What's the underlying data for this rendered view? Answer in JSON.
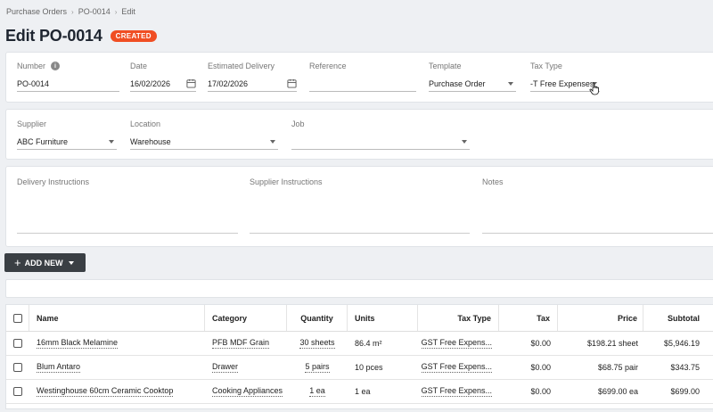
{
  "breadcrumb": {
    "items": [
      "Purchase Orders",
      "PO-0014",
      "Edit"
    ]
  },
  "header": {
    "title": "Edit PO-0014",
    "status": "CREATED"
  },
  "form": {
    "number": {
      "label": "Number",
      "value": "PO-0014"
    },
    "date": {
      "label": "Date",
      "value": "16/02/2026"
    },
    "estimated_delivery": {
      "label": "Estimated Delivery",
      "value": "17/02/2026"
    },
    "reference": {
      "label": "Reference",
      "value": ""
    },
    "template": {
      "label": "Template",
      "value": "Purchase Order"
    },
    "tax_type": {
      "label": "Tax Type",
      "value": "-T Free Expenses"
    },
    "supplier": {
      "label": "Supplier",
      "value": "ABC Furniture"
    },
    "location": {
      "label": "Location",
      "value": "Warehouse"
    },
    "job": {
      "label": "Job",
      "value": ""
    },
    "delivery_instructions": {
      "label": "Delivery Instructions"
    },
    "supplier_instructions": {
      "label": "Supplier Instructions"
    },
    "notes": {
      "label": "Notes"
    }
  },
  "actions": {
    "add_new": "ADD NEW"
  },
  "table": {
    "columns": [
      "Name",
      "Category",
      "Quantity",
      "Units",
      "Tax Type",
      "Tax",
      "Price",
      "Subtotal"
    ],
    "rows": [
      {
        "name": "16mm Black Melamine",
        "category": "PFB MDF Grain",
        "quantity": "30 sheets",
        "units": "86.4 m²",
        "tax_type": "GST Free Expens...",
        "tax": "$0.00",
        "price": "$198.21 sheet",
        "subtotal": "$5,946.19"
      },
      {
        "name": "Blum Antaro",
        "category": "Drawer",
        "quantity": "5 pairs",
        "units": "10 pces",
        "tax_type": "GST Free Expens...",
        "tax": "$0.00",
        "price": "$68.75 pair",
        "subtotal": "$343.75"
      },
      {
        "name": "Westinghouse 60cm Ceramic Cooktop",
        "category": "Cooking Appliances",
        "quantity": "1 ea",
        "units": "1 ea",
        "tax_type": "GST Free Expens...",
        "tax": "$0.00",
        "price": "$699.00 ea",
        "subtotal": "$699.00"
      }
    ]
  },
  "colors": {
    "accent": "#f04e23",
    "button_dark": "#3a3f44",
    "background": "#eef0f3"
  }
}
